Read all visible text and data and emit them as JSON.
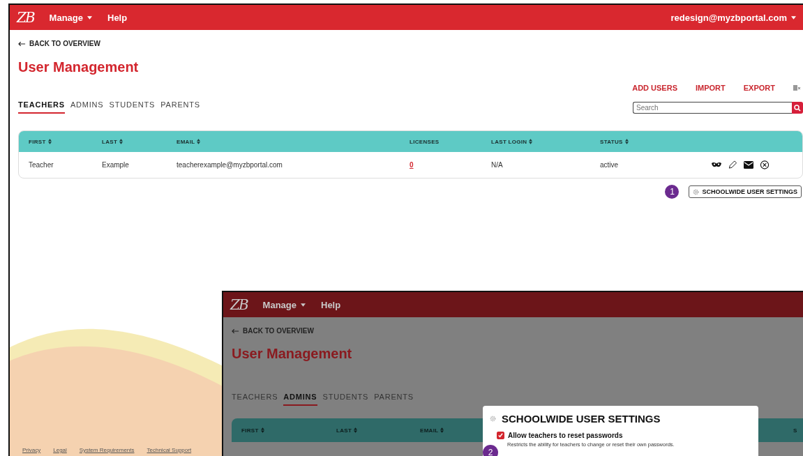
{
  "nav": {
    "logo": "ZB",
    "menu": [
      {
        "label": "Manage",
        "dropdown": true
      },
      {
        "label": "Help",
        "dropdown": false
      }
    ],
    "account": "redesign@myzbportal.com"
  },
  "back_link": "BACK TO OVERVIEW",
  "title": "User Management",
  "actions": [
    "ADD USERS",
    "IMPORT",
    "EXPORT"
  ],
  "search": {
    "placeholder": "Search"
  },
  "tabs": [
    {
      "label": "TEACHERS",
      "selected": true
    },
    {
      "label": "ADMINS",
      "selected": false
    },
    {
      "label": "STUDENTS",
      "selected": false
    },
    {
      "label": "PARENTS",
      "selected": false
    }
  ],
  "table": {
    "columns": [
      {
        "label": "FIRST",
        "sortable": true
      },
      {
        "label": "LAST",
        "sortable": true
      },
      {
        "label": "EMAIL",
        "sortable": true
      },
      {
        "label": "LICENSES",
        "sortable": false
      },
      {
        "label": "LAST LOGIN",
        "sortable": true
      },
      {
        "label": "STATUS",
        "sortable": true
      }
    ],
    "rows": [
      {
        "first": "Teacher",
        "last": "Example",
        "email": "teacherexample@myzbportal.com",
        "licenses": "0",
        "last_login": "N/A",
        "status": "active"
      }
    ]
  },
  "step_marker": "1",
  "settings_button": "SCHOOLWIDE USER SETTINGS",
  "footer_links": [
    "Privacy",
    "Legal",
    "System Requirements",
    "Technical Support"
  ],
  "inset": {
    "nav": {
      "logo": "ZB",
      "menu": [
        {
          "label": "Manage",
          "dropdown": true
        },
        {
          "label": "Help",
          "dropdown": false
        }
      ]
    },
    "back_link": "BACK TO OVERVIEW",
    "title": "User Management",
    "tabs": [
      {
        "label": "TEACHERS",
        "selected": false
      },
      {
        "label": "ADMINS",
        "selected": true
      },
      {
        "label": "STUDENTS",
        "selected": false
      },
      {
        "label": "PARENTS",
        "selected": false
      }
    ],
    "table": {
      "columns": [
        {
          "label": "FIRST",
          "sortable": true
        },
        {
          "label": "LAST",
          "sortable": true
        },
        {
          "label": "EMAIL",
          "sortable": true
        },
        {
          "label": "S",
          "sortable": false
        }
      ]
    },
    "dialog": {
      "title": "SCHOOLWIDE USER SETTINGS",
      "options": [
        {
          "label": "Allow teachers to reset passwords",
          "description": "Restricts the ability for teachers to change or reset their own passwords.",
          "checked": true
        }
      ]
    },
    "step_marker": "2"
  }
}
